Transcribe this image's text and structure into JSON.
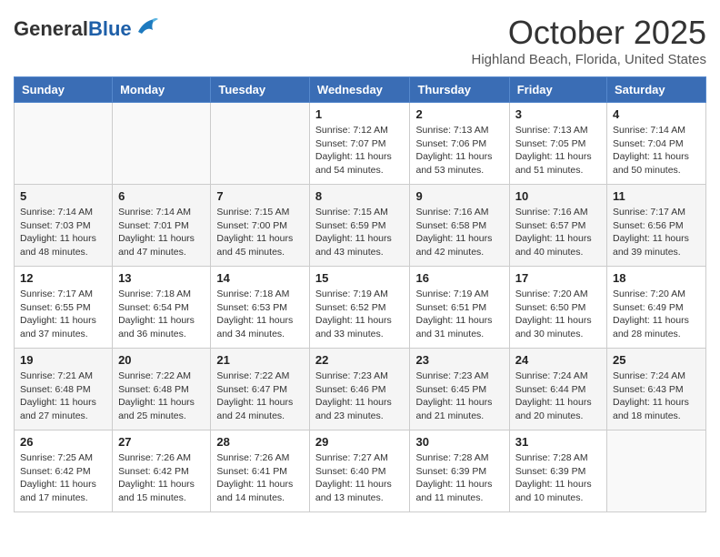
{
  "header": {
    "logo_general": "General",
    "logo_blue": "Blue",
    "month_title": "October 2025",
    "location": "Highland Beach, Florida, United States"
  },
  "days_of_week": [
    "Sunday",
    "Monday",
    "Tuesday",
    "Wednesday",
    "Thursday",
    "Friday",
    "Saturday"
  ],
  "weeks": [
    [
      {
        "day": "",
        "info": ""
      },
      {
        "day": "",
        "info": ""
      },
      {
        "day": "",
        "info": ""
      },
      {
        "day": "1",
        "info": "Sunrise: 7:12 AM\nSunset: 7:07 PM\nDaylight: 11 hours and 54 minutes."
      },
      {
        "day": "2",
        "info": "Sunrise: 7:13 AM\nSunset: 7:06 PM\nDaylight: 11 hours and 53 minutes."
      },
      {
        "day": "3",
        "info": "Sunrise: 7:13 AM\nSunset: 7:05 PM\nDaylight: 11 hours and 51 minutes."
      },
      {
        "day": "4",
        "info": "Sunrise: 7:14 AM\nSunset: 7:04 PM\nDaylight: 11 hours and 50 minutes."
      }
    ],
    [
      {
        "day": "5",
        "info": "Sunrise: 7:14 AM\nSunset: 7:03 PM\nDaylight: 11 hours and 48 minutes."
      },
      {
        "day": "6",
        "info": "Sunrise: 7:14 AM\nSunset: 7:01 PM\nDaylight: 11 hours and 47 minutes."
      },
      {
        "day": "7",
        "info": "Sunrise: 7:15 AM\nSunset: 7:00 PM\nDaylight: 11 hours and 45 minutes."
      },
      {
        "day": "8",
        "info": "Sunrise: 7:15 AM\nSunset: 6:59 PM\nDaylight: 11 hours and 43 minutes."
      },
      {
        "day": "9",
        "info": "Sunrise: 7:16 AM\nSunset: 6:58 PM\nDaylight: 11 hours and 42 minutes."
      },
      {
        "day": "10",
        "info": "Sunrise: 7:16 AM\nSunset: 6:57 PM\nDaylight: 11 hours and 40 minutes."
      },
      {
        "day": "11",
        "info": "Sunrise: 7:17 AM\nSunset: 6:56 PM\nDaylight: 11 hours and 39 minutes."
      }
    ],
    [
      {
        "day": "12",
        "info": "Sunrise: 7:17 AM\nSunset: 6:55 PM\nDaylight: 11 hours and 37 minutes."
      },
      {
        "day": "13",
        "info": "Sunrise: 7:18 AM\nSunset: 6:54 PM\nDaylight: 11 hours and 36 minutes."
      },
      {
        "day": "14",
        "info": "Sunrise: 7:18 AM\nSunset: 6:53 PM\nDaylight: 11 hours and 34 minutes."
      },
      {
        "day": "15",
        "info": "Sunrise: 7:19 AM\nSunset: 6:52 PM\nDaylight: 11 hours and 33 minutes."
      },
      {
        "day": "16",
        "info": "Sunrise: 7:19 AM\nSunset: 6:51 PM\nDaylight: 11 hours and 31 minutes."
      },
      {
        "day": "17",
        "info": "Sunrise: 7:20 AM\nSunset: 6:50 PM\nDaylight: 11 hours and 30 minutes."
      },
      {
        "day": "18",
        "info": "Sunrise: 7:20 AM\nSunset: 6:49 PM\nDaylight: 11 hours and 28 minutes."
      }
    ],
    [
      {
        "day": "19",
        "info": "Sunrise: 7:21 AM\nSunset: 6:48 PM\nDaylight: 11 hours and 27 minutes."
      },
      {
        "day": "20",
        "info": "Sunrise: 7:22 AM\nSunset: 6:48 PM\nDaylight: 11 hours and 25 minutes."
      },
      {
        "day": "21",
        "info": "Sunrise: 7:22 AM\nSunset: 6:47 PM\nDaylight: 11 hours and 24 minutes."
      },
      {
        "day": "22",
        "info": "Sunrise: 7:23 AM\nSunset: 6:46 PM\nDaylight: 11 hours and 23 minutes."
      },
      {
        "day": "23",
        "info": "Sunrise: 7:23 AM\nSunset: 6:45 PM\nDaylight: 11 hours and 21 minutes."
      },
      {
        "day": "24",
        "info": "Sunrise: 7:24 AM\nSunset: 6:44 PM\nDaylight: 11 hours and 20 minutes."
      },
      {
        "day": "25",
        "info": "Sunrise: 7:24 AM\nSunset: 6:43 PM\nDaylight: 11 hours and 18 minutes."
      }
    ],
    [
      {
        "day": "26",
        "info": "Sunrise: 7:25 AM\nSunset: 6:42 PM\nDaylight: 11 hours and 17 minutes."
      },
      {
        "day": "27",
        "info": "Sunrise: 7:26 AM\nSunset: 6:42 PM\nDaylight: 11 hours and 15 minutes."
      },
      {
        "day": "28",
        "info": "Sunrise: 7:26 AM\nSunset: 6:41 PM\nDaylight: 11 hours and 14 minutes."
      },
      {
        "day": "29",
        "info": "Sunrise: 7:27 AM\nSunset: 6:40 PM\nDaylight: 11 hours and 13 minutes."
      },
      {
        "day": "30",
        "info": "Sunrise: 7:28 AM\nSunset: 6:39 PM\nDaylight: 11 hours and 11 minutes."
      },
      {
        "day": "31",
        "info": "Sunrise: 7:28 AM\nSunset: 6:39 PM\nDaylight: 11 hours and 10 minutes."
      },
      {
        "day": "",
        "info": ""
      }
    ]
  ]
}
